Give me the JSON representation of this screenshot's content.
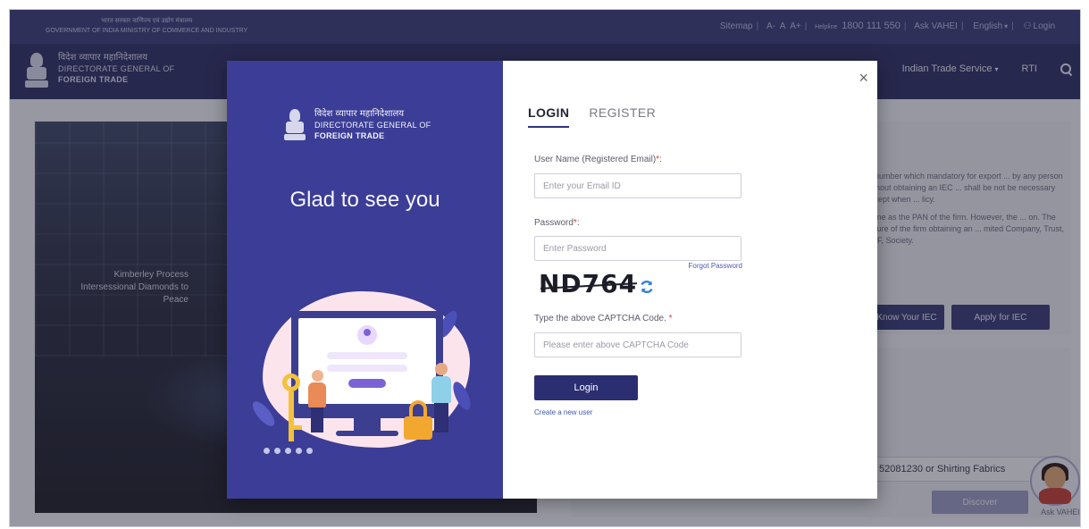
{
  "topbar": {
    "gov_hindi": "भारत सरकार वाणिज्य एवं उद्योग मंत्रालय",
    "gov_english": "GOVERNMENT OF INDIA MINISTRY OF COMMERCE AND INDUSTRY",
    "sitemap": "Sitemap",
    "font_small": "A-",
    "font_normal": "A",
    "font_large": "A+",
    "helpline_label": "Helpline",
    "helpline_number": "1800 111 550",
    "ask_vahei": "Ask VAHEI",
    "language": "English",
    "login": "Login"
  },
  "header": {
    "org_hindi": "विदेश व्यापार महानिदेशालय",
    "org_line1": "DIRECTORATE GENERAL OF",
    "org_line2": "FOREIGN TRADE",
    "nav_indian_trade_service": "Indian Trade Service",
    "nav_rti": "RTI"
  },
  "background": {
    "hero_caption": "Kimberley Process Intersessional Diamonds to Peace",
    "iec_text_1": "... number which mandatory for export ... by any person without obtaining an IEC ... shall be not be necessary except when ... licy.",
    "iec_text_2": "... me as the PAN of the firm. However, the ... on. The nature of the firm obtaining an ... mited Company, Trust, HUF, Society.",
    "know_iec_button": "Know Your IEC",
    "apply_iec_button": "Apply for IEC",
    "discover_value": "52081230 or Shirting Fabrics",
    "discover_button": "Discover",
    "vahei_label": "Ask VAHEI"
  },
  "modal": {
    "left": {
      "org_hindi": "विदेश व्यापार महानिदेशालय",
      "org_line1": "DIRECTORATE GENERAL OF",
      "org_line2": "FOREIGN TRADE",
      "greeting": "Glad to see you"
    },
    "tabs": [
      {
        "label": "LOGIN",
        "active": true
      },
      {
        "label": "REGISTER",
        "active": false
      }
    ],
    "username_label": "User Name (Registered Email)",
    "username_required": "*",
    "username_placeholder": "Enter your Email ID",
    "password_label": "Password",
    "password_required": "*",
    "password_placeholder": "Enter Password",
    "forgot_password": "Forgot Password",
    "captcha_text": "ND764",
    "captcha_label": "Type the above CAPTCHA Code.",
    "captcha_required": "*",
    "captcha_placeholder": "Please enter above CAPTCHA Code",
    "login_button": "Login",
    "create_user": "Create a new user"
  },
  "colors": {
    "brand_dark": "#2d2f64",
    "modal_left": "#3b3d96",
    "button": "#2c2e72",
    "link": "#3d58b8",
    "required": "#d23a3a"
  }
}
